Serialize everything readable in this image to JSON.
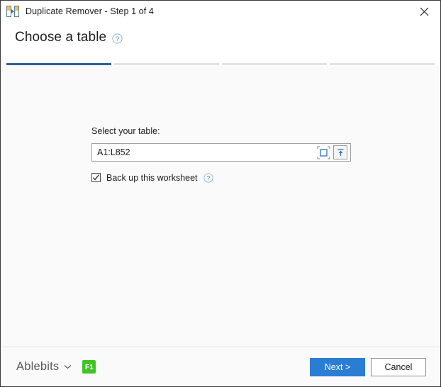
{
  "window": {
    "title": "Duplicate Remover - Step 1 of 4",
    "app_icon": "duplicate-remover-icon",
    "close_label": "✕"
  },
  "header": {
    "title": "Choose a table",
    "help_icon": "help-circle-icon"
  },
  "steps": {
    "current": 1,
    "total": 4,
    "active_color": "#2a6099",
    "inactive_color": "#e2e2e2",
    "segments": [
      "1",
      "2",
      "3",
      "4"
    ]
  },
  "form": {
    "range_label": "Select your table:",
    "range_value": "A1:L852",
    "range_placeholder": "Select a range",
    "pick_range_icon": "select-range-icon",
    "collapse_icon": "collapse-dialog-icon",
    "backup_label": "Back up this worksheet",
    "backup_checked": true,
    "backup_help_icon": "help-circle-icon"
  },
  "footer": {
    "brand": "Ablebits",
    "brand_chevron": "chevron-down-icon",
    "help_key": "F1",
    "help_key_color": "#3fc426",
    "next_label": "Next >",
    "cancel_label": "Cancel"
  }
}
